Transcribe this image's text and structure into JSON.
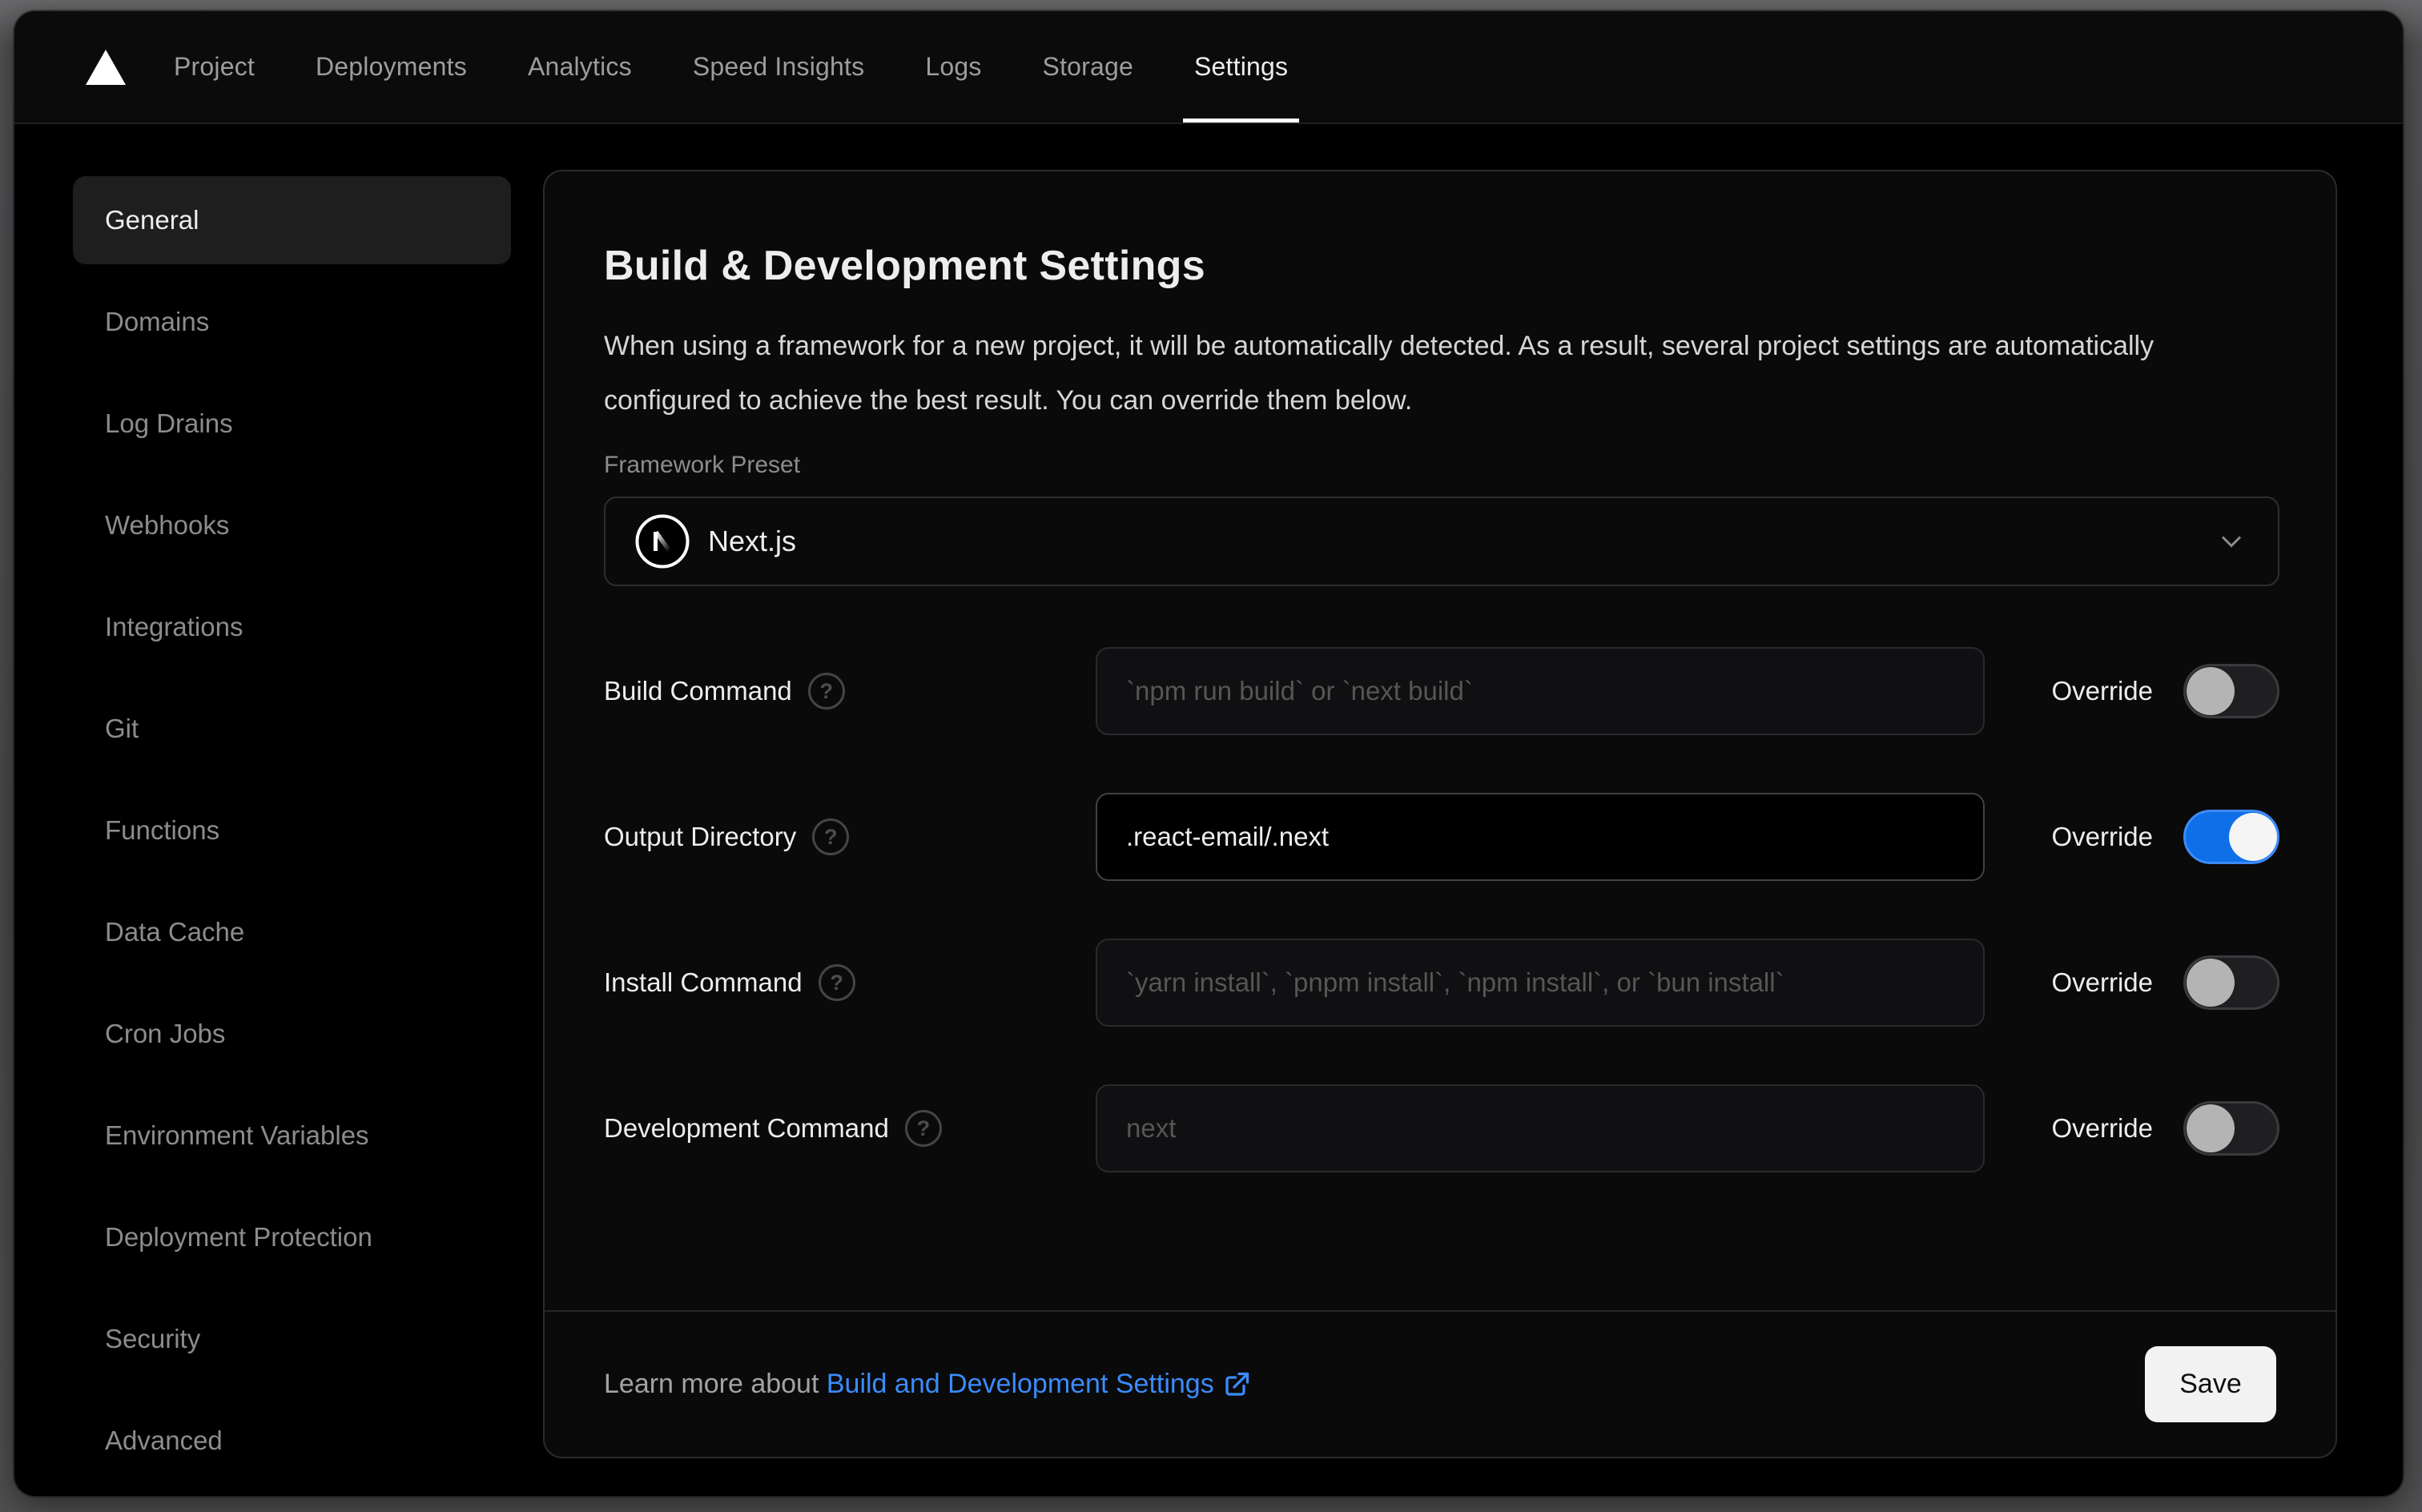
{
  "nav": {
    "items": [
      {
        "label": "Project",
        "active": false
      },
      {
        "label": "Deployments",
        "active": false
      },
      {
        "label": "Analytics",
        "active": false
      },
      {
        "label": "Speed Insights",
        "active": false
      },
      {
        "label": "Logs",
        "active": false
      },
      {
        "label": "Storage",
        "active": false
      },
      {
        "label": "Settings",
        "active": true
      }
    ]
  },
  "sidebar": {
    "items": [
      {
        "label": "General",
        "active": true
      },
      {
        "label": "Domains",
        "active": false
      },
      {
        "label": "Log Drains",
        "active": false
      },
      {
        "label": "Webhooks",
        "active": false
      },
      {
        "label": "Integrations",
        "active": false
      },
      {
        "label": "Git",
        "active": false
      },
      {
        "label": "Functions",
        "active": false
      },
      {
        "label": "Data Cache",
        "active": false
      },
      {
        "label": "Cron Jobs",
        "active": false
      },
      {
        "label": "Environment Variables",
        "active": false
      },
      {
        "label": "Deployment Protection",
        "active": false
      },
      {
        "label": "Security",
        "active": false
      },
      {
        "label": "Advanced",
        "active": false
      }
    ]
  },
  "panel": {
    "title": "Build & Development Settings",
    "description": "When using a framework for a new project, it will be automatically detected. As a result, several project settings are automatically configured to achieve the best result. You can override them below.",
    "framework_preset": {
      "label": "Framework Preset",
      "value": "Next.js",
      "icon": "nextjs-logo"
    },
    "rows": [
      {
        "label": "Build Command",
        "placeholder": "`npm run build` or `next build`",
        "value": "",
        "override_label": "Override",
        "override_on": false
      },
      {
        "label": "Output Directory",
        "placeholder": "",
        "value": ".react-email/.next",
        "override_label": "Override",
        "override_on": true
      },
      {
        "label": "Install Command",
        "placeholder": "`yarn install`, `pnpm install`, `npm install`, or `bun install`",
        "value": "",
        "override_label": "Override",
        "override_on": false
      },
      {
        "label": "Development Command",
        "placeholder": "next",
        "value": "",
        "override_label": "Override",
        "override_on": false
      }
    ],
    "footer": {
      "learn_more_prefix": "Learn more about ",
      "link_label": "Build and Development Settings",
      "save_label": "Save"
    }
  },
  "colors": {
    "toggle_on_blue": "#0f6fe8",
    "link_blue": "#3b8bfd",
    "background": "#000000",
    "backdrop_gray": "#4a4a4c"
  }
}
